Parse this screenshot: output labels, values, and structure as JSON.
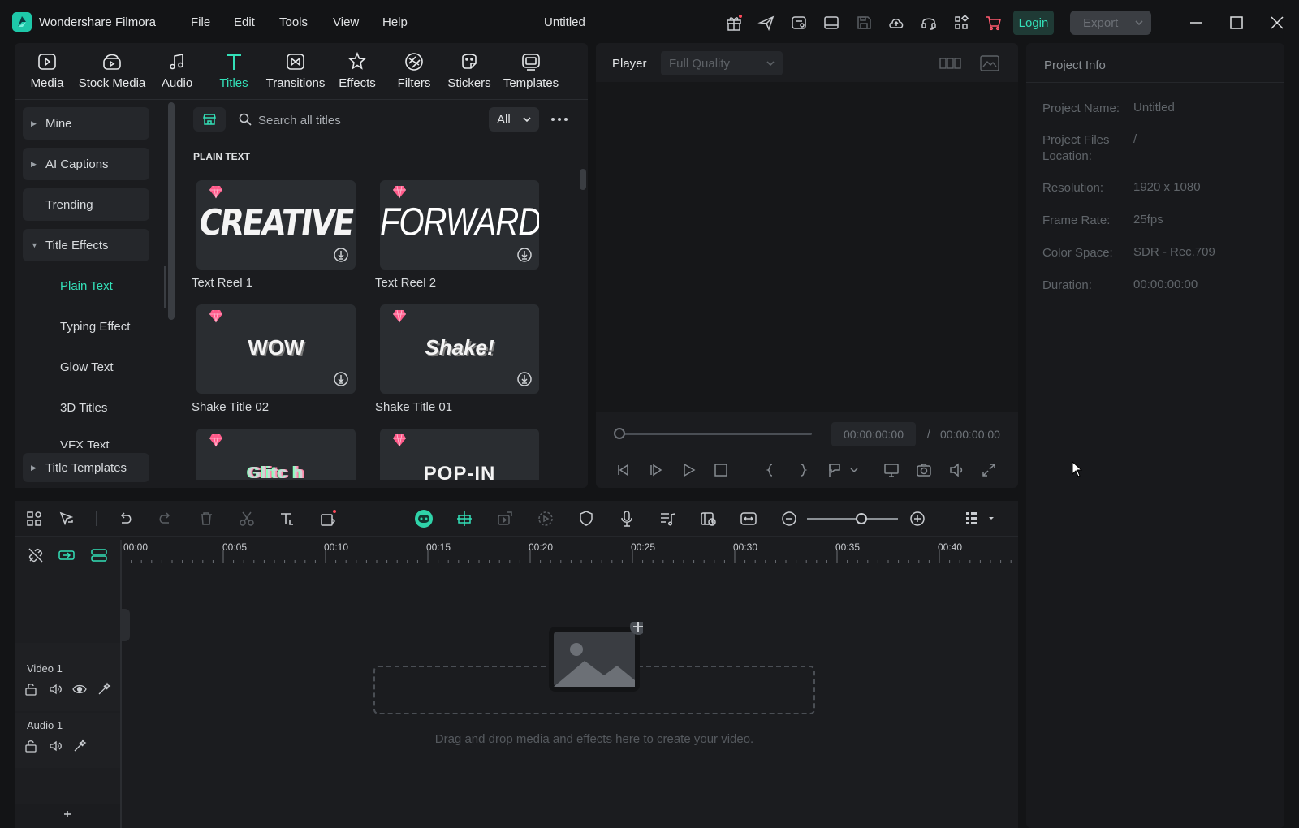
{
  "app": {
    "name": "Wondershare Filmora",
    "doc_title": "Untitled"
  },
  "menu": [
    "File",
    "Edit",
    "Tools",
    "View",
    "Help"
  ],
  "header_buttons": {
    "login": "Login",
    "export": "Export"
  },
  "media_tabs": [
    {
      "label": "Media",
      "icon": "media-icon"
    },
    {
      "label": "Stock Media",
      "icon": "stock-media-icon"
    },
    {
      "label": "Audio",
      "icon": "audio-icon"
    },
    {
      "label": "Titles",
      "icon": "titles-icon",
      "active": true
    },
    {
      "label": "Transitions",
      "icon": "transitions-icon"
    },
    {
      "label": "Effects",
      "icon": "effects-icon"
    },
    {
      "label": "Filters",
      "icon": "filters-icon"
    },
    {
      "label": "Stickers",
      "icon": "stickers-icon"
    },
    {
      "label": "Templates",
      "icon": "templates-icon"
    }
  ],
  "categories": {
    "mine": "Mine",
    "ai_captions": "AI Captions",
    "trending": "Trending",
    "title_effects": "Title Effects",
    "sub": [
      "Plain Text",
      "Typing Effect",
      "Glow Text",
      "3D Titles",
      "VFX Text"
    ],
    "title_templates": "Title Templates"
  },
  "search": {
    "placeholder": "Search all titles",
    "filter": "All"
  },
  "section_header": "PLAIN TEXT",
  "thumbnails": [
    {
      "label": "Text Reel 1",
      "art": "CREATIVE"
    },
    {
      "label": "Text Reel 2",
      "art": "FORWARD"
    },
    {
      "label": "Shake Title 02",
      "art": "WOW"
    },
    {
      "label": "Shake Title 01",
      "art": "Shake!"
    },
    {
      "label": "",
      "art": "Glitc h"
    },
    {
      "label": "",
      "art": "POP-IN"
    }
  ],
  "player": {
    "label": "Player",
    "quality": "Full Quality",
    "current_time": "00:00:00:00",
    "separator": "/",
    "total_time": "00:00:00:00"
  },
  "project_info": {
    "title": "Project Info",
    "rows": [
      {
        "key": "Project Name:",
        "value": "Untitled"
      },
      {
        "key": "Project Files Location:",
        "value": "/"
      },
      {
        "key": "Resolution:",
        "value": "1920 x 1080"
      },
      {
        "key": "Frame Rate:",
        "value": "25fps"
      },
      {
        "key": "Color Space:",
        "value": "SDR - Rec.709"
      },
      {
        "key": "Duration:",
        "value": "00:00:00:00"
      }
    ]
  },
  "timeline": {
    "ruler": [
      "00:00",
      "00:05",
      "00:10",
      "00:15",
      "00:20",
      "00:25",
      "00:30",
      "00:35",
      "00:40"
    ],
    "tracks": [
      "Video 1",
      "Audio 1"
    ],
    "drop_hint": "Drag and drop media and effects here to create your video."
  },
  "colors": {
    "accent": "#33e0b8",
    "bg": "#131416",
    "panel": "#1b1c1f"
  }
}
